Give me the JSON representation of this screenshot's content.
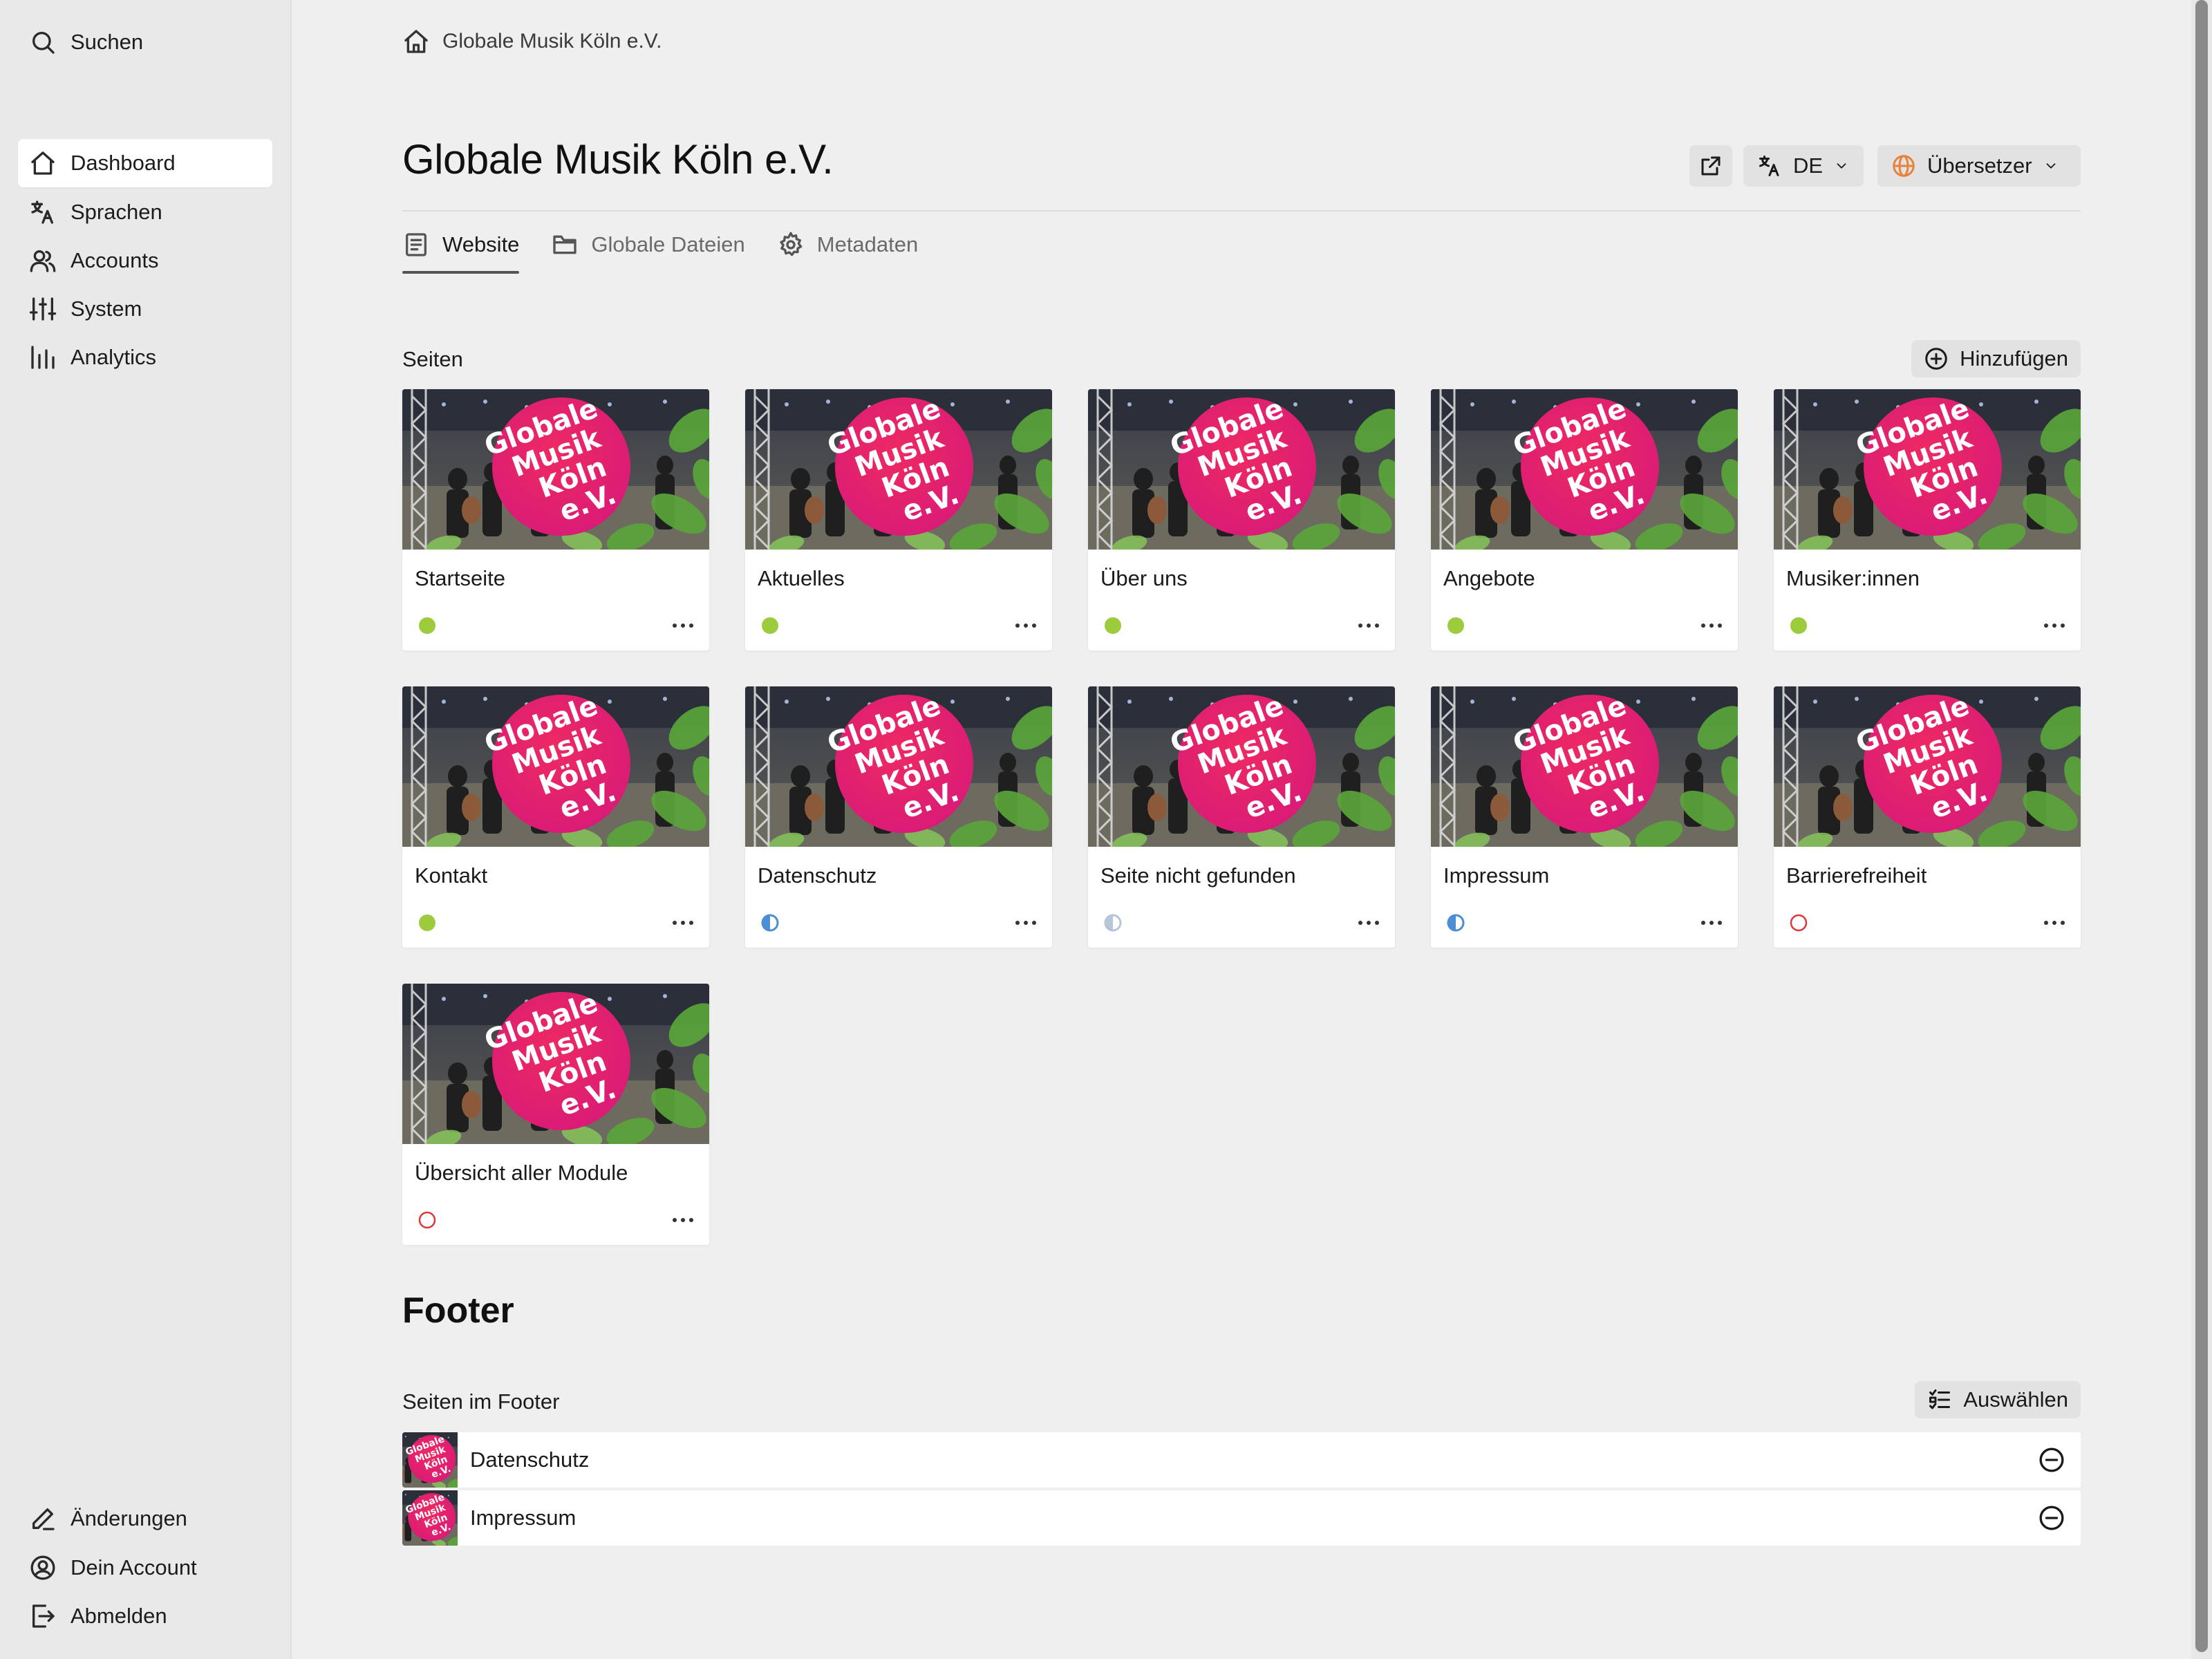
{
  "sidebar": {
    "search_label": "Suchen",
    "items": [
      {
        "label": "Dashboard",
        "icon": "home-icon",
        "active": true
      },
      {
        "label": "Sprachen",
        "icon": "translate-icon"
      },
      {
        "label": "Accounts",
        "icon": "users-icon"
      },
      {
        "label": "System",
        "icon": "sliders-icon"
      },
      {
        "label": "Analytics",
        "icon": "bar-chart-icon"
      }
    ],
    "bottom_items": [
      {
        "label": "Änderungen",
        "icon": "pencil-icon"
      },
      {
        "label": "Dein Account",
        "icon": "user-circle-icon"
      },
      {
        "label": "Abmelden",
        "icon": "logout-icon"
      }
    ]
  },
  "breadcrumb": {
    "label": "Globale Musik Köln e.V."
  },
  "header": {
    "title": "Globale Musik Köln e.V.",
    "language": "DE",
    "role": "Übersetzer"
  },
  "tabs": [
    {
      "label": "Website",
      "icon": "document-icon",
      "active": true
    },
    {
      "label": "Globale Dateien",
      "icon": "folder-icon"
    },
    {
      "label": "Metadaten",
      "icon": "gear-icon"
    }
  ],
  "pages_section": {
    "label": "Seiten",
    "add_label": "Hinzufügen",
    "thumbnail_text": [
      "Globale",
      "Musik",
      "Köln",
      "e.V."
    ],
    "pages": [
      {
        "title": "Startseite",
        "status": "published"
      },
      {
        "title": "Aktuelles",
        "status": "published"
      },
      {
        "title": "Über uns",
        "status": "published"
      },
      {
        "title": "Angebote",
        "status": "published"
      },
      {
        "title": "Musiker:innen",
        "status": "published"
      },
      {
        "title": "Kontakt",
        "status": "published"
      },
      {
        "title": "Datenschutz",
        "status": "partial"
      },
      {
        "title": "Seite nicht gefunden",
        "status": "partial-faded"
      },
      {
        "title": "Impressum",
        "status": "partial"
      },
      {
        "title": "Barrierefreiheit",
        "status": "unpublished"
      },
      {
        "title": "Übersicht aller Module",
        "status": "unpublished"
      }
    ]
  },
  "footer": {
    "heading": "Footer",
    "pages_label": "Seiten im Footer",
    "select_label": "Auswählen",
    "items": [
      {
        "label": "Datenschutz"
      },
      {
        "label": "Impressum"
      }
    ]
  },
  "colors": {
    "published": "#9ccb3b",
    "partial": "#4a8fd6",
    "partial_faded": "#b5c6d8",
    "unpublished": "#d83a3a",
    "brand_pink": "#e21f6f",
    "translator_globe": "#e8823a"
  }
}
